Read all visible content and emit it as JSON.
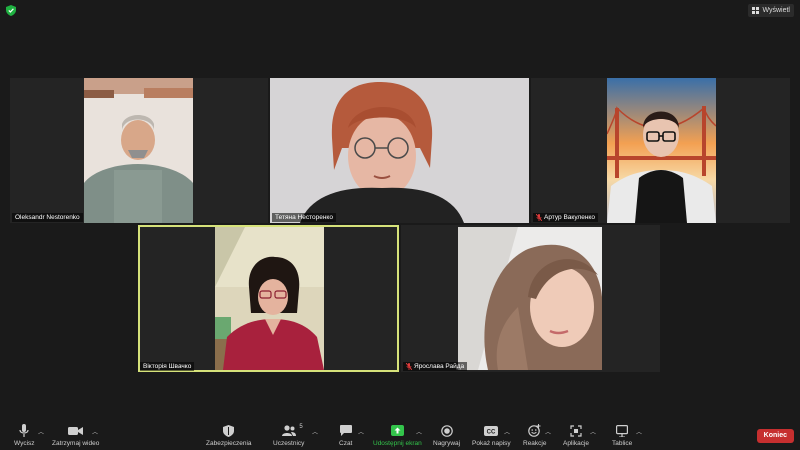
{
  "top": {
    "view_label": "Wyświetl"
  },
  "participants": [
    {
      "name": "Oleksandr Nestorenko",
      "muted": false
    },
    {
      "name": "Тетяна Несторенко",
      "muted": false
    },
    {
      "name": "Артур Вакуленко",
      "muted": true
    },
    {
      "name": "Вікторія Швачко",
      "muted": false,
      "active_speaker": true
    },
    {
      "name": "Ярослава Райда",
      "muted": true
    }
  ],
  "participants_count": "5",
  "toolbar": {
    "mute": "Wycisz",
    "video": "Zatrzymaj wideo",
    "security": "Zabezpieczenia",
    "participants": "Uczestnicy",
    "chat": "Czat",
    "share": "Udostępnij ekran",
    "record": "Nagrywaj",
    "captions": "Pokaż napisy",
    "reactions": "Reakcje",
    "apps": "Aplikacje",
    "whiteboards": "Tablice",
    "end": "Koniec"
  },
  "colors": {
    "background": "#1a1a1a",
    "tile": "#242424",
    "active_border": "#d6e27a",
    "share_green": "#33c44b",
    "end_red": "#c62f2f",
    "security_green": "#1fb141"
  }
}
